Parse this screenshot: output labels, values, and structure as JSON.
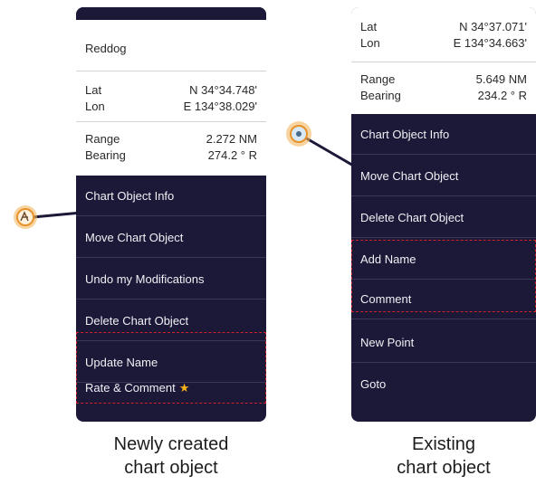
{
  "left": {
    "name": "Reddog",
    "lat_label": "Lat",
    "lat_value": "N 34°34.748'",
    "lon_label": "Lon",
    "lon_value": "E 134°38.029'",
    "range_label": "Range",
    "range_value": "2.272 NM",
    "bearing_label": "Bearing",
    "bearing_value": "274.2 ° R",
    "menu": [
      "Chart Object Info",
      "Move Chart Object",
      "Undo my Modifications",
      "Delete Chart Object",
      "Update Name",
      "Rate & Comment"
    ],
    "star_icon": "star-icon",
    "caption_line1": "Newly created",
    "caption_line2": "chart object"
  },
  "right": {
    "lat_label": "Lat",
    "lat_value": "N 34°37.071'",
    "lon_label": "Lon",
    "lon_value": "E 134°34.663'",
    "range_label": "Range",
    "range_value": "5.649 NM",
    "bearing_label": "Bearing",
    "bearing_value": "234.2 ° R",
    "menu": [
      "Chart Object Info",
      "Move Chart Object",
      "Delete Chart Object",
      "Add Name",
      "Comment",
      "New Point",
      "Goto"
    ],
    "caption_line1": "Existing",
    "caption_line2": "chart object"
  },
  "colors": {
    "panel_bg": "#1b1838",
    "highlight_dash": "#d0202a",
    "marker_orange": "#f0a030",
    "star": "#f6b21a"
  }
}
